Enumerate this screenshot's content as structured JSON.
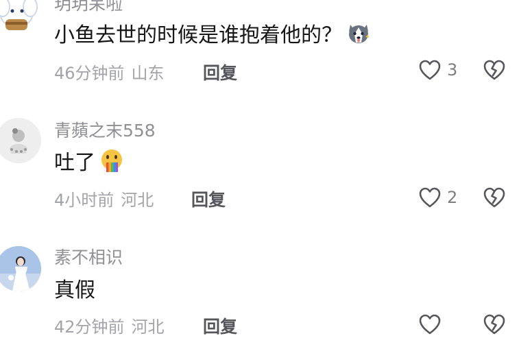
{
  "comments": [
    {
      "username": "玥玥呆啦",
      "content": "小鱼去世的时候是谁抱着他的？",
      "emoji": "husky-dog-face",
      "time": "46分钟前",
      "location": "山东",
      "reply_label": "回复",
      "likes": "3"
    },
    {
      "username": "青蘋之末558",
      "content": "吐了",
      "emoji": "vomiting-face",
      "time": "4小时前",
      "location": "河北",
      "reply_label": "回复",
      "likes": "2"
    },
    {
      "username": "素不相识",
      "content": "真假",
      "emoji": "",
      "time": "42分钟前",
      "location": "河北",
      "reply_label": "回复",
      "likes": ""
    }
  ]
}
